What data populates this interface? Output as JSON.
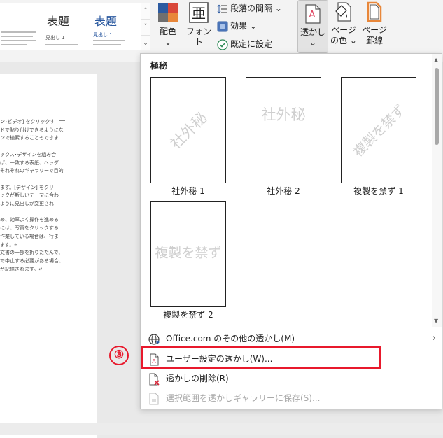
{
  "ribbon": {
    "styles": [
      {
        "title": "",
        "heading": ""
      },
      {
        "title": "表題",
        "heading": "見出し 1"
      },
      {
        "title": "表題",
        "heading": "見出し 1"
      }
    ],
    "colors_label": "配色",
    "fonts_label": "フォント",
    "paragraph_spacing_label": "段落の間隔",
    "effects_label": "効果",
    "set_default_label": "既定に設定",
    "watermark_label": "透かし",
    "page_color_label_1": "ページ",
    "page_color_label_2": "の色",
    "page_borders_label_1": "ページ",
    "page_borders_label_2": "罫線",
    "colors": {
      "red": "#d9473a",
      "blue": "#2c5aa0",
      "orange": "#e8873a",
      "gray": "#6f6f6f"
    }
  },
  "document": {
    "lines": [
      "ン･ビデオ] をクリックす",
      "ドで貼り付けできるようにな",
      "ンで検索することもできま",
      "",
      "ックス･デザインを組み合",
      "ば、一致する表紙、ヘッダ",
      "それぞれのギャラリーで目的",
      "",
      "ます。[デザイン] をクリ",
      "ックが新しいテーマに合わ",
      "ように見出しが変更され",
      "",
      "め、効率よく操作を進める",
      "には、写真をクリックする",
      "作業している場合は、行ま",
      "ます。↵",
      "文書の一部を折りたたんで、",
      "で中止する必要がある場合、",
      "が記憶されます。↵"
    ]
  },
  "panel": {
    "header": "極秘",
    "watermarks": [
      {
        "text": "社外秘",
        "label": "社外秘 1",
        "style": "diagonal"
      },
      {
        "text": "社外秘",
        "label": "社外秘 2",
        "style": "horizontal"
      },
      {
        "text": "複製を禁ず",
        "label": "複製を禁ず 1",
        "style": "diagonal"
      },
      {
        "text": "複製を禁ず",
        "label": "複製を禁ず 2",
        "style": "horizontal"
      }
    ],
    "menu": {
      "more_watermarks": "Office.com のその他の透かし(M)",
      "custom_watermark": "ユーザー設定の透かし(W)...",
      "remove_watermark": "透かしの削除(R)",
      "save_selection": "選択範囲を透かしギャラリーに保存(S)..."
    }
  },
  "annotation": {
    "step_number": "③",
    "highlight_color": "#e8192c"
  }
}
